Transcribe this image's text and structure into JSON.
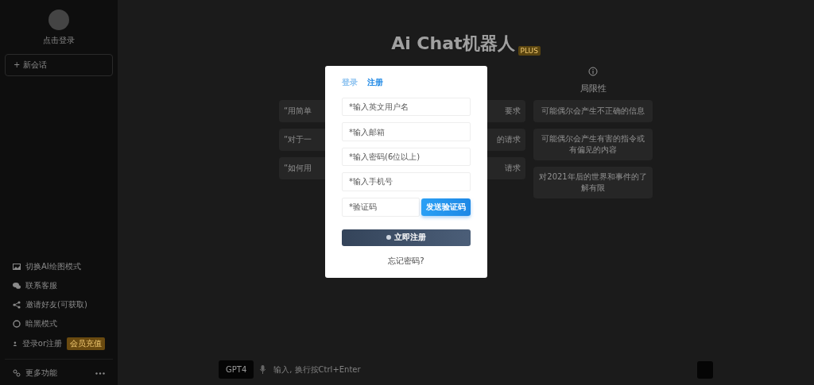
{
  "sidebar": {
    "user": {
      "label": "点击登录"
    },
    "new_chat": "+ 新会话",
    "menu": [
      {
        "label": "切换AI绘图模式"
      },
      {
        "label": "联系客服"
      },
      {
        "label": "邀请好友(可获取)"
      },
      {
        "label": "暗黑模式"
      },
      {
        "label": "登录or注册",
        "badge": "会员充值"
      }
    ],
    "more": {
      "label": "更多功能"
    }
  },
  "main": {
    "title": "Ai Chat机器人",
    "title_badge": "PLUS",
    "columns": [
      {
        "cards": [
          "“用简单",
          "“对于一",
          "“如何用"
        ]
      },
      {
        "cards": [
          "要求",
          "的请求",
          "请求"
        ]
      },
      {
        "heading": "局限性",
        "cards": [
          "可能偶尔会产生不正确的信息",
          "可能偶尔会产生有害的指令或有偏见的内容",
          "对2021年后的世界和事件的了解有限"
        ]
      }
    ],
    "input": {
      "model": "GPT4",
      "placeholder": "输入, 换行按Ctrl+Enter"
    }
  },
  "dialog": {
    "tabs": [
      {
        "label": "登录",
        "selected": false
      },
      {
        "label": "注册",
        "selected": true
      }
    ],
    "fields": [
      {
        "placeholder": "*输入英文用户名"
      },
      {
        "placeholder": "*输入邮箱"
      },
      {
        "placeholder": "*输入密码(6位以上)"
      },
      {
        "placeholder": "*输入手机号"
      }
    ],
    "code": {
      "placeholder": "*验证码",
      "button": "发送验证码"
    },
    "submit": "立即注册",
    "forgot": "忘记密码?"
  }
}
